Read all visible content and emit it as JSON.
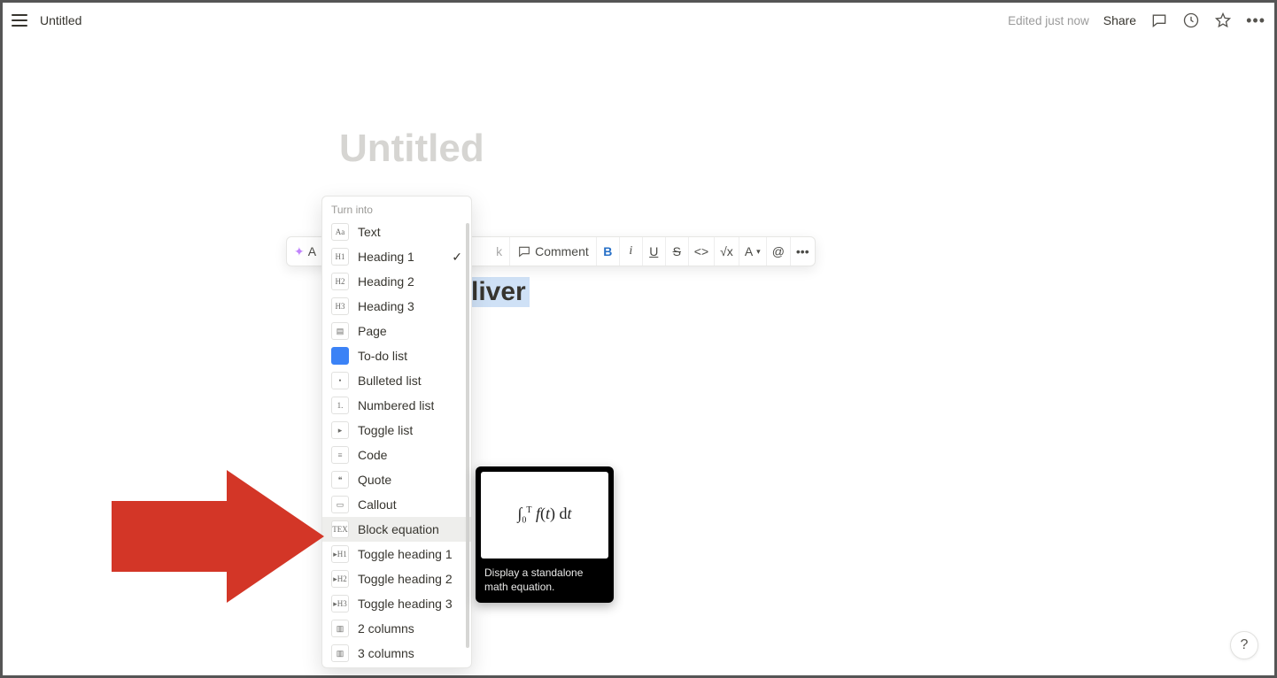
{
  "topbar": {
    "doc_title": "Untitled",
    "edited_text": "Edited just now",
    "share_label": "Share"
  },
  "page": {
    "title_placeholder": "Untitled",
    "visible_heading_fragment": "liver"
  },
  "format_bar": {
    "ask_ai": "A",
    "link": "k",
    "comment": "Comment",
    "bold": "B",
    "italic": "i",
    "underline": "U",
    "strike": "S",
    "code": "<>",
    "equation": "√x",
    "color": "A",
    "mention": "@",
    "more": "•••"
  },
  "menu": {
    "header": "Turn into",
    "items": [
      {
        "label": "Text",
        "icon": "Aa"
      },
      {
        "label": "Heading 1",
        "icon": "H1",
        "checked": true
      },
      {
        "label": "Heading 2",
        "icon": "H2"
      },
      {
        "label": "Heading 3",
        "icon": "H3"
      },
      {
        "label": "Page",
        "icon": "▤"
      },
      {
        "label": "To-do list",
        "icon": "todo"
      },
      {
        "label": "Bulleted list",
        "icon": "•"
      },
      {
        "label": "Numbered list",
        "icon": "1."
      },
      {
        "label": "Toggle list",
        "icon": "▸"
      },
      {
        "label": "Code",
        "icon": "≡"
      },
      {
        "label": "Quote",
        "icon": "❝"
      },
      {
        "label": "Callout",
        "icon": "▭"
      },
      {
        "label": "Block equation",
        "icon": "TEX",
        "hover": true
      },
      {
        "label": "Toggle heading 1",
        "icon": "▸H1"
      },
      {
        "label": "Toggle heading 2",
        "icon": "▸H2"
      },
      {
        "label": "Toggle heading 3",
        "icon": "▸H3"
      },
      {
        "label": "2 columns",
        "icon": "▥"
      },
      {
        "label": "3 columns",
        "icon": "▥"
      }
    ]
  },
  "preview": {
    "formula_display": "∫₀ᵀ f(t) dt",
    "description": "Display a standalone math equation."
  },
  "help_label": "?"
}
